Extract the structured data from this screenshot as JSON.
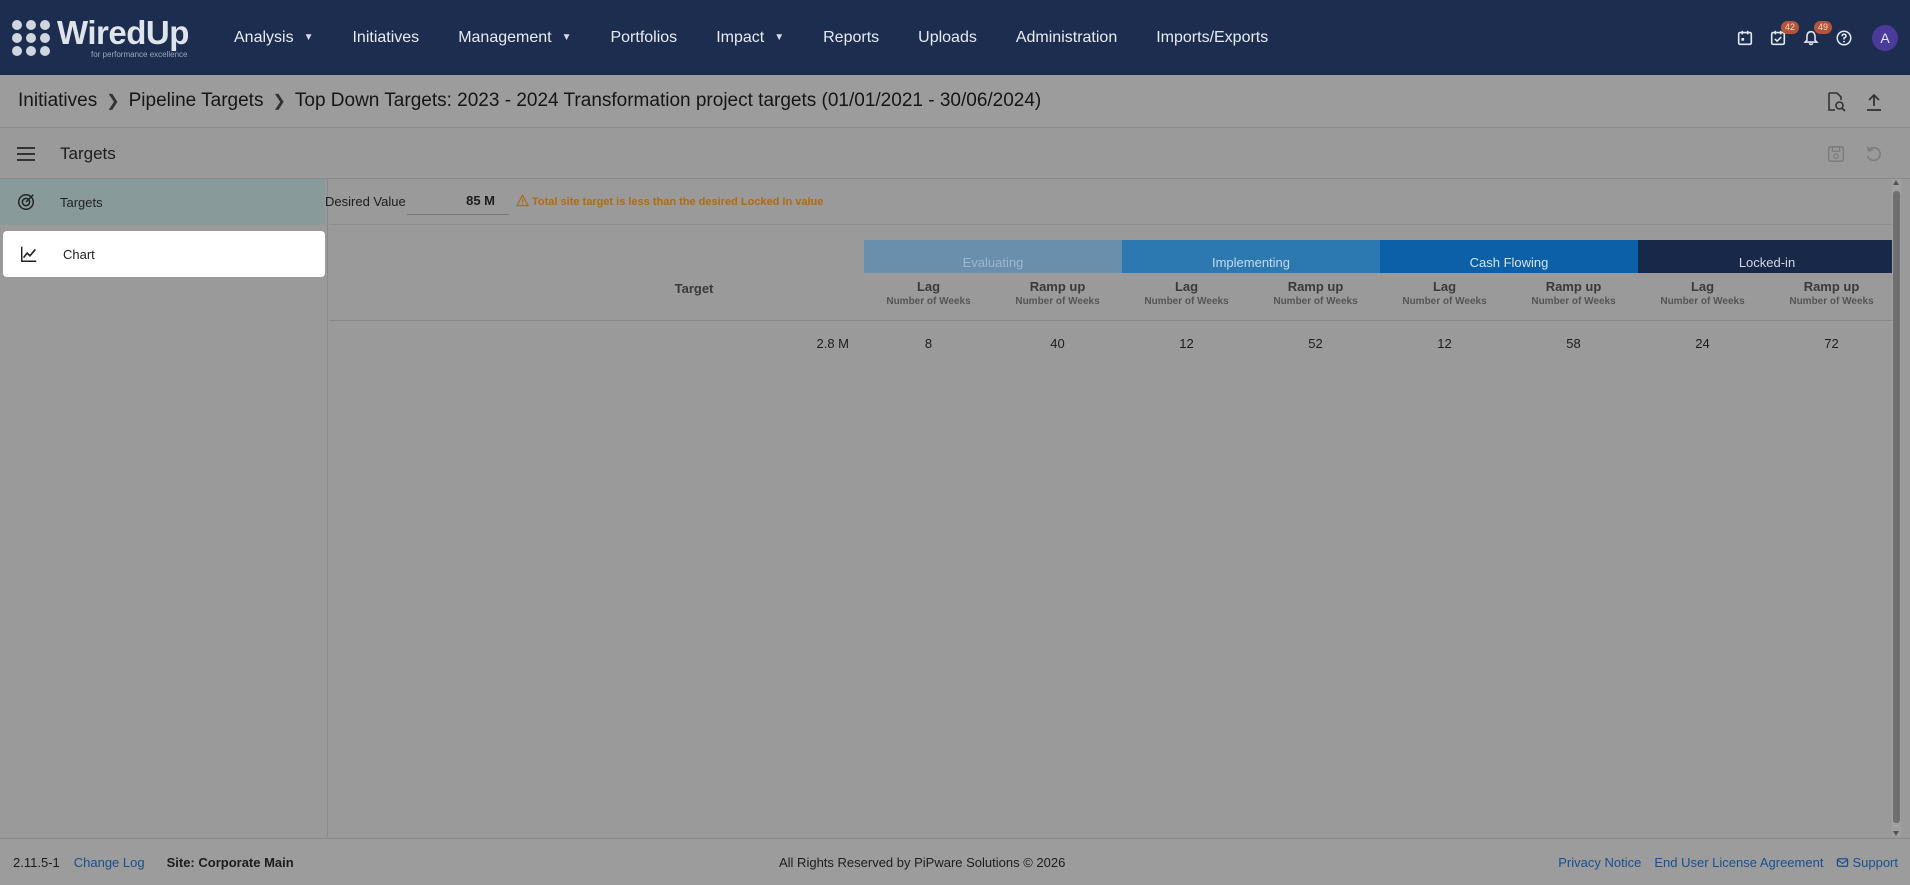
{
  "app": {
    "logo_text": "WiredUp",
    "logo_tagline": "for performance excellence"
  },
  "nav": [
    {
      "label": "Analysis",
      "dropdown": true
    },
    {
      "label": "Initiatives",
      "dropdown": false
    },
    {
      "label": "Management",
      "dropdown": true
    },
    {
      "label": "Portfolios",
      "dropdown": false
    },
    {
      "label": "Impact",
      "dropdown": true
    },
    {
      "label": "Reports",
      "dropdown": false
    },
    {
      "label": "Uploads",
      "dropdown": false
    },
    {
      "label": "Administration",
      "dropdown": false
    },
    {
      "label": "Imports/Exports",
      "dropdown": false
    }
  ],
  "top_icons": {
    "calendar": "calendar-icon",
    "tasks": {
      "icon": "task-check-icon",
      "badge": "42"
    },
    "notifications": {
      "icon": "bell-icon",
      "badge": "49"
    },
    "help": "help-icon",
    "avatar": "A"
  },
  "breadcrumb": [
    "Initiatives",
    "Pipeline Targets",
    "Top Down Targets: 2023 - 2024 Transformation project targets (01/01/2021 - 30/06/2024)"
  ],
  "subheader": {
    "title": "Targets"
  },
  "sidebar": [
    {
      "label": "Targets",
      "icon": "target-icon",
      "state": "default"
    },
    {
      "label": "Chart",
      "icon": "chart-line-icon",
      "state": "highlighted"
    }
  ],
  "desired": {
    "label": "Desired Value",
    "value": "85 M",
    "warning": "Total site target is less than the desired Locked In value"
  },
  "table": {
    "target_header": "Target",
    "stages": [
      {
        "name": "Evaluating",
        "color": "#6a8fac"
      },
      {
        "name": "Implementing",
        "color": "#2c79b2"
      },
      {
        "name": "Cash Flowing",
        "color": "#0b60a8"
      },
      {
        "name": "Locked-in",
        "color": "#182848"
      }
    ],
    "columns": [
      {
        "title": "Lag",
        "sub": "Number of Weeks"
      },
      {
        "title": "Ramp up",
        "sub": "Number of Weeks"
      },
      {
        "title": "Lag",
        "sub": "Number of Weeks"
      },
      {
        "title": "Ramp up",
        "sub": "Number of Weeks"
      },
      {
        "title": "Lag",
        "sub": "Number of Weeks"
      },
      {
        "title": "Ramp up",
        "sub": "Number of Weeks"
      },
      {
        "title": "Lag",
        "sub": "Number of Weeks"
      },
      {
        "title": "Ramp up",
        "sub": "Number of Weeks"
      }
    ],
    "row": {
      "target": "2.8 M",
      "values": [
        "8",
        "40",
        "12",
        "52",
        "12",
        "58",
        "24",
        "72"
      ]
    }
  },
  "footer": {
    "version": "2.11.5-1",
    "change_log": "Change Log",
    "site": "Site: Corporate Main",
    "rights": "All Rights Reserved by PiPware Solutions © 2026",
    "privacy": "Privacy Notice",
    "eula": "End User License Agreement",
    "support": "Support"
  }
}
